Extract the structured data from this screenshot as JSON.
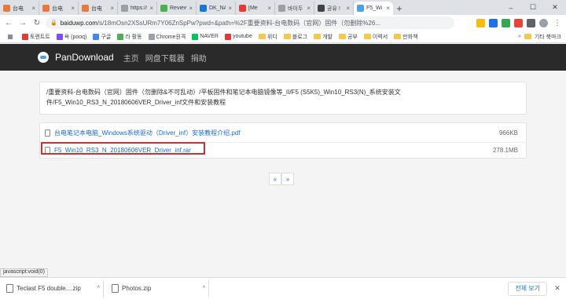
{
  "tabs": [
    {
      "label": "台电",
      "color": "#e8793a"
    },
    {
      "label": "台电",
      "color": "#e8793a"
    },
    {
      "label": "台电",
      "color": "#e8793a"
    },
    {
      "label": "https://",
      "color": "#9aa0a6"
    },
    {
      "label": "Review",
      "color": "#4caf50"
    },
    {
      "label": "DK_NA",
      "color": "#1976d2"
    },
    {
      "label": "[Me",
      "color": "#e53935"
    },
    {
      "label": "바이두",
      "color": "#9aa0a6"
    },
    {
      "label": "공유 !",
      "color": "#424242"
    },
    {
      "label": "F5_Wi",
      "color": "#4aa3df"
    }
  ],
  "address": {
    "host": "baiduwp.com",
    "rest": "/s/18mOsn2XSsURm7Y06ZnSpPw?pwd=&path=%2F重要资料-台电数码（官网）固件（勿删除%26..."
  },
  "bookmarks": [
    {
      "label": "토렌트트",
      "color": "#e53935"
    },
    {
      "label": "욕 (pooq)",
      "color": "#7c4dff"
    },
    {
      "label": "구글",
      "color": "#4285f4"
    },
    {
      "label": "라 활동",
      "color": "#4caf50"
    },
    {
      "label": "Chrome원격",
      "color": "#9aa0a6"
    },
    {
      "label": "NAVER",
      "color": "#03c75a"
    },
    {
      "label": "youtube",
      "color": "#e53935"
    },
    {
      "label": "위디",
      "color": "folder"
    },
    {
      "label": "블로그",
      "color": "folder"
    },
    {
      "label": "개발",
      "color": "folder"
    },
    {
      "label": "공부",
      "color": "folder"
    },
    {
      "label": "이력서",
      "color": "folder"
    },
    {
      "label": "만화책",
      "color": "folder"
    }
  ],
  "bookmarks_other": "기타 북마크",
  "site": {
    "brand": "PanDownload",
    "nav": [
      "主页",
      "网盘下载器",
      "捐助"
    ]
  },
  "path_text": "/重要资料-台电数码（官网）固件（勿删除&不可乱动）/平板固件和笔记本电脑镜像等_II/F5 (S5K5)_Win10_RS3(N)_系统安装文件/F5_Win10_RS3_N_20180606VER_Driver_inf文件和安装教程",
  "files": [
    {
      "name": "台电笔记本电脑_Windows系统驱动（Driver_inf）安装教程介绍.pdf",
      "size": "966KB"
    },
    {
      "name": "F5_Win10_RS3_N_20180606VER_Driver_inf.rar",
      "size": "278.1MB"
    }
  ],
  "pager": {
    "prev": "«",
    "next": "»"
  },
  "status_url": "javascript:void(0)",
  "downloads": [
    {
      "name": "Teclast F5 double....zip"
    },
    {
      "name": "Photos.zip"
    }
  ],
  "show_all": "전체 보기"
}
